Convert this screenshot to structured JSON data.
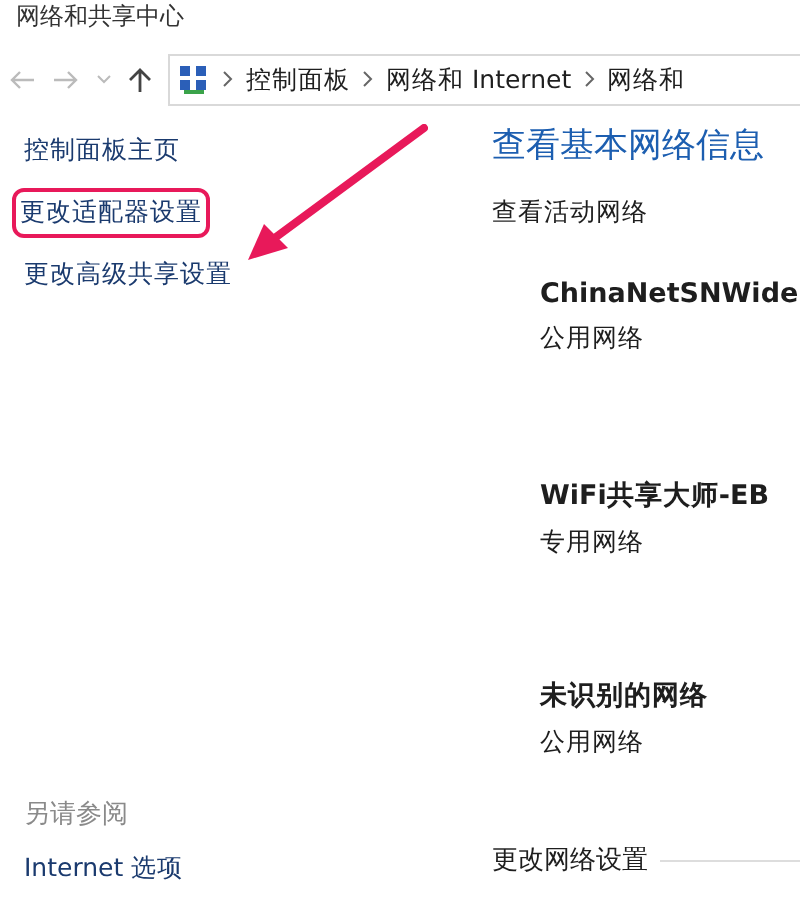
{
  "window": {
    "title": "网络和共享中心"
  },
  "navigation": {
    "breadcrumbs": [
      "控制面板",
      "网络和 Internet",
      "网络和"
    ]
  },
  "sidebar": {
    "items": [
      {
        "label": "控制面板主页",
        "highlighted": false
      },
      {
        "label": "更改适配器设置",
        "highlighted": true
      },
      {
        "label": "更改高级共享设置",
        "highlighted": false
      }
    ],
    "see_also": {
      "heading": "另请参阅",
      "items": [
        "Internet 选项"
      ]
    }
  },
  "main": {
    "heading": "查看基本网络信息",
    "active_heading": "查看活动网络",
    "networks": [
      {
        "name": "ChinaNetSNWide",
        "type": "公用网络"
      },
      {
        "name": "WiFi共享大师-EB",
        "type": "专用网络"
      },
      {
        "name": "未识别的网络",
        "type": "公用网络"
      }
    ],
    "change_heading": "更改网络设置"
  }
}
